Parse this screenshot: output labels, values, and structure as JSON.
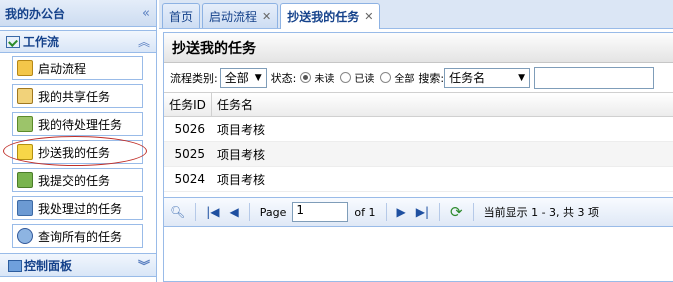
{
  "sidebar": {
    "title": "我的办公台",
    "section_title": "工作流",
    "items": [
      {
        "label": "启动流程"
      },
      {
        "label": "我的共享任务"
      },
      {
        "label": "我的待处理任务"
      },
      {
        "label": "抄送我的任务"
      },
      {
        "label": "我提交的任务"
      },
      {
        "label": "我处理过的任务"
      },
      {
        "label": "查询所有的任务"
      }
    ],
    "panel2_title": "控制面板"
  },
  "tabs": [
    {
      "label": "首页"
    },
    {
      "label": "启动流程"
    },
    {
      "label": "抄送我的任务"
    }
  ],
  "content": {
    "title": "抄送我的任务",
    "filter": {
      "category_label": "流程类别:",
      "category_value": "全部",
      "status_label": "状态:",
      "status_options": [
        "未读",
        "已读",
        "全部"
      ],
      "search_label": "搜索:",
      "search_field": "任务名",
      "search_value": ""
    },
    "columns": [
      "任务ID",
      "任务名"
    ],
    "rows": [
      {
        "id": "5026",
        "name": "项目考核"
      },
      {
        "id": "5025",
        "name": "项目考核"
      },
      {
        "id": "5024",
        "name": "项目考核"
      }
    ],
    "pager": {
      "page_label": "Page",
      "page_value": "1",
      "of_label": "of 1",
      "status": "当前显示 1 - 3, 共 3 项"
    }
  }
}
